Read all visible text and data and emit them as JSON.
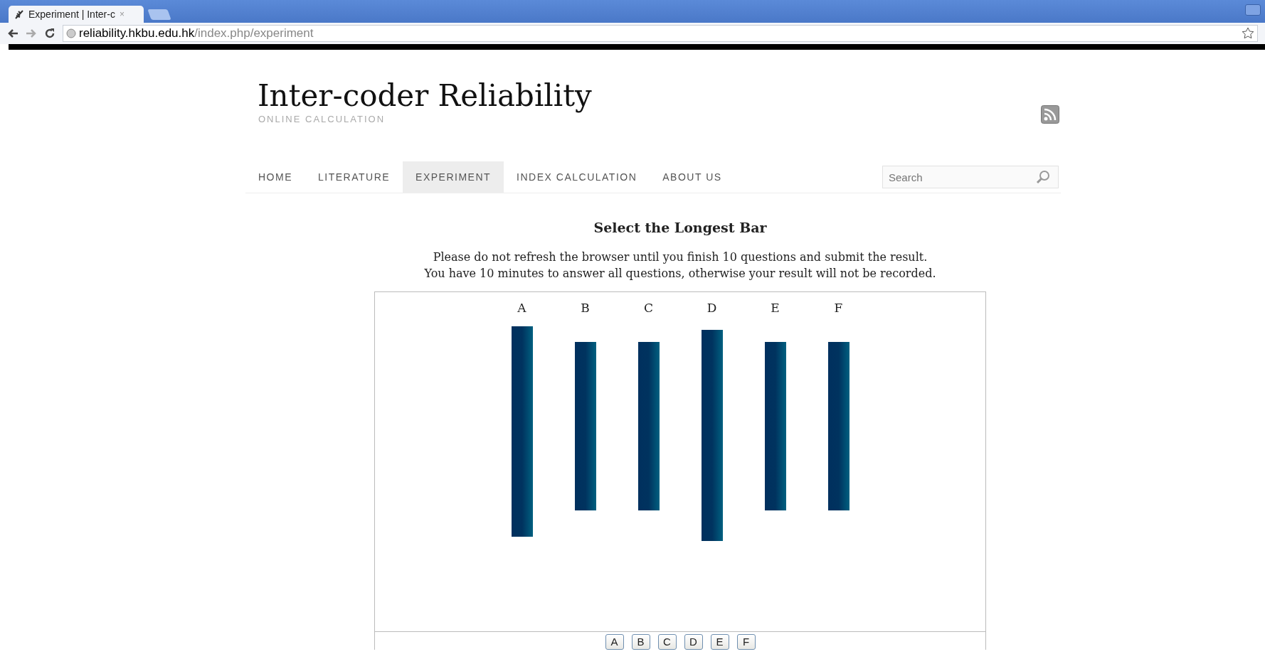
{
  "browser": {
    "tab_title": "Experiment | Inter-c",
    "tab_close": "×",
    "url_host": "reliability.hkbu.edu.hk",
    "url_path": "/index.php/experiment"
  },
  "site": {
    "title": "Inter-coder Reliability",
    "tagline": "ONLINE CALCULATION"
  },
  "nav": [
    {
      "label": "HOME",
      "selected": false
    },
    {
      "label": "LITERATURE",
      "selected": false
    },
    {
      "label": "EXPERIMENT",
      "selected": true
    },
    {
      "label": "INDEX CALCULATION",
      "selected": false
    },
    {
      "label": "ABOUT US",
      "selected": false
    }
  ],
  "search": {
    "placeholder": "Search"
  },
  "heading": "Select the Longest Bar",
  "instructions": [
    "Please do not refresh the browser until you finish 10 questions and submit the result.",
    "You have 10 minutes to answer all questions, otherwise your result will not be recorded."
  ],
  "bar_labels": [
    "A",
    "B",
    "C",
    "D",
    "E",
    "F"
  ],
  "answer_buttons": [
    "A",
    "B",
    "C",
    "D",
    "E",
    "F"
  ]
}
